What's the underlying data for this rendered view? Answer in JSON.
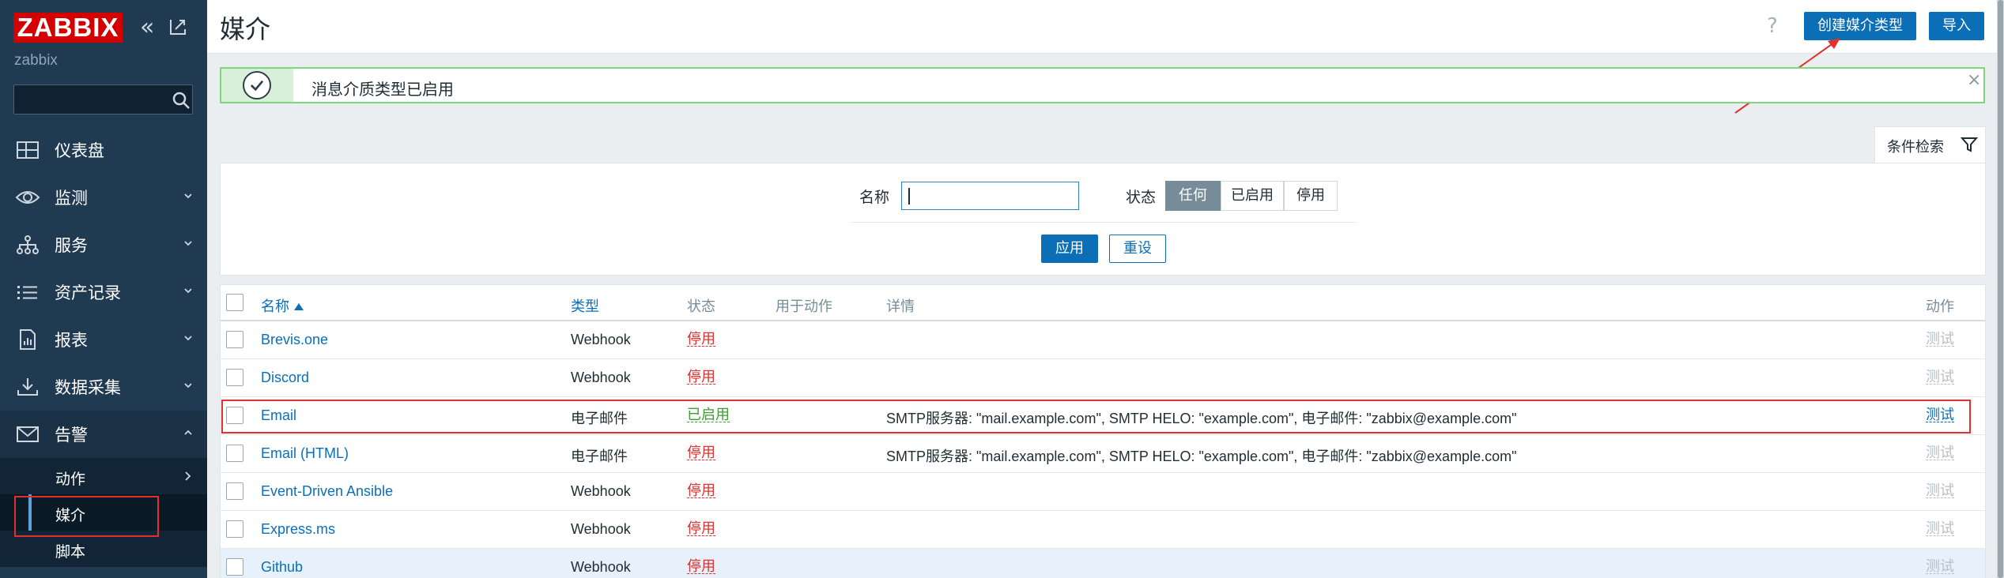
{
  "app": {
    "logo": "ZABBIX",
    "server_name": "zabbix"
  },
  "sidebar": {
    "search_placeholder": "",
    "items": [
      {
        "label": "仪表盘",
        "icon": "dashboard-icon",
        "has_children": false
      },
      {
        "label": "监测",
        "icon": "eye-icon",
        "has_children": true
      },
      {
        "label": "服务",
        "icon": "services-icon",
        "has_children": true
      },
      {
        "label": "资产记录",
        "icon": "list-icon",
        "has_children": true
      },
      {
        "label": "报表",
        "icon": "report-icon",
        "has_children": true
      },
      {
        "label": "数据采集",
        "icon": "download-icon",
        "has_children": true
      },
      {
        "label": "告警",
        "icon": "envelope-icon",
        "has_children": true,
        "expanded": true
      }
    ],
    "alerts_submenu": [
      {
        "label": "动作",
        "has_children": true
      },
      {
        "label": "媒介",
        "active": true
      },
      {
        "label": "脚本"
      }
    ]
  },
  "header": {
    "title": "媒介",
    "help": "?",
    "create_button": "创建媒介类型",
    "import_button": "导入"
  },
  "message": {
    "text": "消息介质类型已启用",
    "close": "×"
  },
  "filter": {
    "tab_label": "条件检索",
    "name_label": "名称",
    "name_value": "",
    "status_label": "状态",
    "status_options": [
      "任何",
      "已启用",
      "停用"
    ],
    "status_selected": "任何",
    "apply_button": "应用",
    "reset_button": "重设"
  },
  "table": {
    "columns": {
      "name": "名称",
      "type": "类型",
      "status": "状态",
      "used_in_actions": "用于动作",
      "details": "详情",
      "action": "动作"
    },
    "rows": [
      {
        "name": "Brevis.one",
        "type": "Webhook",
        "status": "停用",
        "status_kind": "disabled",
        "details": "",
        "action": "测试"
      },
      {
        "name": "Discord",
        "type": "Webhook",
        "status": "停用",
        "status_kind": "disabled",
        "details": "",
        "action": "测试"
      },
      {
        "name": "Email",
        "type": "电子邮件",
        "status": "已启用",
        "status_kind": "enabled",
        "details": "SMTP服务器: \"mail.example.com\", SMTP HELO: \"example.com\", 电子邮件: \"zabbix@example.com\"",
        "action": "测试"
      },
      {
        "name": "Email (HTML)",
        "type": "电子邮件",
        "status": "停用",
        "status_kind": "disabled",
        "details": "SMTP服务器: \"mail.example.com\", SMTP HELO: \"example.com\", 电子邮件: \"zabbix@example.com\"",
        "action": "测试"
      },
      {
        "name": "Event-Driven Ansible",
        "type": "Webhook",
        "status": "停用",
        "status_kind": "disabled",
        "details": "",
        "action": "测试"
      },
      {
        "name": "Express.ms",
        "type": "Webhook",
        "status": "停用",
        "status_kind": "disabled",
        "details": "",
        "action": "测试"
      },
      {
        "name": "Github",
        "type": "Webhook",
        "status": "停用",
        "status_kind": "disabled",
        "details": "",
        "action": "测试"
      }
    ]
  },
  "colors": {
    "sidebar_bg": "#1f3a51",
    "accent": "#0b6fb8",
    "disabled": "#e2312d",
    "enabled": "#3f9b38",
    "annotation": "#e2312d"
  }
}
